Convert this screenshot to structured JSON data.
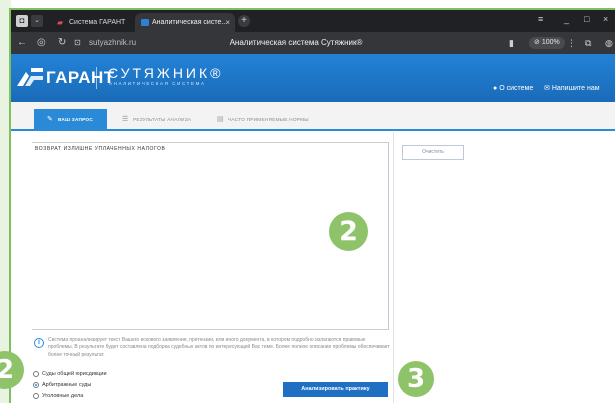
{
  "browser": {
    "tabs": [
      {
        "label": "Система ГАРАНТ"
      },
      {
        "label": "Аналитическая систе..."
      }
    ],
    "new_tab": "+",
    "close_tab": "×",
    "url": "sutyazhnik.ru",
    "page_title": "Аналитическая система Сутяжник®",
    "zoom": "100%",
    "window_controls": [
      "≡",
      "_",
      "□",
      "×"
    ]
  },
  "site": {
    "brand": "ГАРАНТ",
    "product": "СУТЯЖНИК®",
    "product_subtitle": "АНАЛИТИЧЕСКАЯ СИСТЕМА",
    "header_links": [
      {
        "label": "О системе",
        "icon": "info-icon"
      },
      {
        "label": "Напишите нам",
        "icon": "mail-icon"
      }
    ],
    "colors": {
      "brand_blue": "#1f73c4",
      "accent": "#2a8ad8"
    }
  },
  "tabs": [
    {
      "label": "ВАШ ЗАПРОС",
      "active": true,
      "icon": "edit-icon"
    },
    {
      "label": "РЕЗУЛЬТАТЫ АНАЛИЗА",
      "active": false,
      "icon": "list-icon"
    },
    {
      "label": "ЧАСТО ПРИМЕНЯЕМЫЕ НОРМЫ",
      "active": false,
      "icon": "document-icon"
    }
  ],
  "query": {
    "text": "ВОЗВРАТ ИЗЛИШНЕ УПЛАЧЕННЫХ НАЛОГОВ",
    "clear_label": "Очистить",
    "info": "Система проанализирует текст Вашего искового заявления, претензии, или иного документа, в котором подробно излагаются правовые проблемы. В результате будет составлена подборка судебных актов по интересующей Вас теме. Более полное описание проблемы обеспечивает более точный результат."
  },
  "court_options": [
    {
      "label": "Суды общей юрисдикции",
      "selected": false
    },
    {
      "label": "Арбитражные суды",
      "selected": true
    },
    {
      "label": "Уголовные дела",
      "selected": false
    }
  ],
  "analyze_label": "Анализировать практику",
  "badges": [
    "2",
    "2",
    "3"
  ]
}
